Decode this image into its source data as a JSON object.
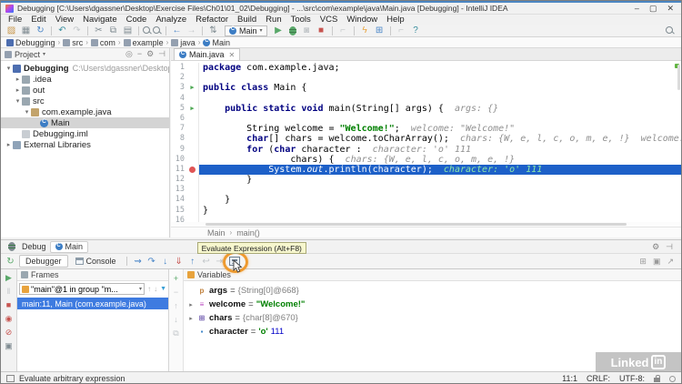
{
  "window": {
    "title": "Debugging [C:\\Users\\dgassner\\Desktop\\Exercise Files\\Ch01\\01_02\\Debugging] - ...\\src\\com\\example\\java\\Main.java [Debugging] - IntelliJ IDEA",
    "minimize": "–",
    "maximize": "▢",
    "close": "✕"
  },
  "menu": [
    "File",
    "Edit",
    "View",
    "Navigate",
    "Code",
    "Analyze",
    "Refactor",
    "Build",
    "Run",
    "Tools",
    "VCS",
    "Window",
    "Help"
  ],
  "toolbar": {
    "run_config": "Main",
    "icons": [
      {
        "name": "open",
        "g": "▨",
        "c": "folder"
      },
      {
        "name": "save-all",
        "g": "▦",
        "c": "g"
      },
      {
        "name": "sync",
        "g": "↻",
        "c": "b"
      },
      {
        "name": "sep"
      },
      {
        "name": "undo",
        "g": "↶",
        "c": "t"
      },
      {
        "name": "redo",
        "g": "↷",
        "c": "d"
      },
      {
        "name": "sep"
      },
      {
        "name": "cut",
        "g": "✂",
        "c": "g"
      },
      {
        "name": "copy",
        "g": "⧉",
        "c": "g"
      },
      {
        "name": "paste",
        "g": "▤",
        "c": "g"
      },
      {
        "name": "sep"
      },
      {
        "name": "find",
        "g": "mag"
      },
      {
        "name": "replace",
        "g": "mag"
      },
      {
        "name": "sep"
      },
      {
        "name": "back",
        "g": "←",
        "c": "b"
      },
      {
        "name": "forward",
        "g": "→",
        "c": "d"
      },
      {
        "name": "sep"
      },
      {
        "name": "sort-lines",
        "g": "⇅",
        "c": "g"
      },
      {
        "name": "runconfig"
      },
      {
        "name": "run",
        "g": "▶",
        "c": "grn"
      },
      {
        "name": "debug",
        "g": "bug"
      },
      {
        "name": "run-with-coverage",
        "g": "◙",
        "c": "d"
      },
      {
        "name": "stop",
        "g": "■",
        "c": "red"
      },
      {
        "name": "sep"
      },
      {
        "name": "attach-profiler",
        "g": "⌐",
        "c": "d"
      },
      {
        "name": "sep"
      },
      {
        "name": "find-action",
        "g": "ϟ",
        "c": "y"
      },
      {
        "name": "project-structure",
        "g": "⊞",
        "c": "b"
      },
      {
        "name": "sep"
      },
      {
        "name": "disabled-tool",
        "g": "⌐",
        "c": "d"
      },
      {
        "name": "help",
        "g": "?",
        "c": "t"
      }
    ]
  },
  "breadcrumbs": [
    {
      "label": "Debugging",
      "icon": "project"
    },
    {
      "label": "src",
      "icon": "folder"
    },
    {
      "label": "com",
      "icon": "folder"
    },
    {
      "label": "example",
      "icon": "folder"
    },
    {
      "label": "java",
      "icon": "folder"
    },
    {
      "label": "Main",
      "icon": "class"
    }
  ],
  "project": {
    "header": "Project",
    "header_icons": [
      {
        "name": "locate-file",
        "g": "◎"
      },
      {
        "name": "collapse-all",
        "g": "−"
      },
      {
        "name": "settings-gear",
        "g": "⚙"
      },
      {
        "name": "hide-panel",
        "g": "⊣"
      }
    ],
    "tree": [
      {
        "level": 0,
        "chev": "▾",
        "icon": "project",
        "name": "Debugging",
        "suffix": "C:\\Users\\dgassner\\Desktop\\Exercise Files\\Ch",
        "bold": true
      },
      {
        "level": 1,
        "chev": "▸",
        "icon": "folder",
        "name": ".idea"
      },
      {
        "level": 1,
        "chev": "▸",
        "icon": "folder",
        "name": "out"
      },
      {
        "level": 1,
        "chev": "▾",
        "icon": "folder",
        "name": "src"
      },
      {
        "level": 2,
        "chev": "▾",
        "icon": "package",
        "name": "com.example.java"
      },
      {
        "level": 3,
        "chev": "",
        "icon": "class",
        "name": "Main",
        "selected": true
      },
      {
        "level": 1,
        "chev": "",
        "icon": "file",
        "name": "Debugging.iml"
      },
      {
        "level": 0,
        "chev": "▸",
        "icon": "lib",
        "name": "External Libraries"
      }
    ]
  },
  "editor": {
    "tab": "Main.java",
    "tab_close": "✕",
    "breadcrumb": [
      "Main",
      "main()"
    ],
    "lines": [
      {
        "n": 1,
        "seg": [
          [
            "k",
            "package "
          ],
          [
            "p",
            "com.example.java;"
          ]
        ]
      },
      {
        "n": 2,
        "seg": []
      },
      {
        "n": 3,
        "icon": "run",
        "seg": [
          [
            "k",
            "public class "
          ],
          [
            "p",
            "Main {"
          ]
        ]
      },
      {
        "n": 4,
        "seg": []
      },
      {
        "n": 5,
        "icon": "run",
        "seg": [
          [
            "p",
            "    "
          ],
          [
            "k",
            "public static void "
          ],
          [
            "p",
            "main(String[] args) {  "
          ],
          [
            "h",
            "args: {}"
          ]
        ]
      },
      {
        "n": 6,
        "seg": []
      },
      {
        "n": 7,
        "seg": [
          [
            "p",
            "        String welcome = "
          ],
          [
            "s",
            "\"Welcome!\""
          ],
          [
            "p",
            ";  "
          ],
          [
            "h",
            "welcome: \"Welcome!\""
          ]
        ]
      },
      {
        "n": 8,
        "seg": [
          [
            "p",
            "        "
          ],
          [
            "k",
            "char"
          ],
          [
            "p",
            "[] chars = welcome.toCharArray();  "
          ],
          [
            "h",
            "chars: {W, e, l, c, o, m, e, !}  welcome: \"Welco"
          ]
        ]
      },
      {
        "n": 9,
        "seg": [
          [
            "p",
            "        "
          ],
          [
            "k",
            "for"
          ],
          [
            "p",
            " ("
          ],
          [
            "k",
            "char"
          ],
          [
            "p",
            " character :  "
          ],
          [
            "h",
            "character: 'o' 111"
          ]
        ]
      },
      {
        "n": 10,
        "seg": [
          [
            "p",
            "                chars) {  "
          ],
          [
            "h",
            "chars: {W, e, l, c, o, m, e, !}"
          ]
        ]
      },
      {
        "n": 11,
        "icon": "bp",
        "exec": true,
        "seg": [
          [
            "p",
            "            System."
          ],
          [
            "it",
            "out"
          ],
          [
            "p",
            ".println(character);  "
          ],
          [
            "hx",
            "character: 'o' 111"
          ]
        ]
      },
      {
        "n": 12,
        "seg": [
          [
            "p",
            "        }"
          ]
        ]
      },
      {
        "n": 13,
        "seg": []
      },
      {
        "n": 14,
        "seg": [
          [
            "p",
            "    }"
          ]
        ]
      },
      {
        "n": 15,
        "seg": [
          [
            "p",
            "}"
          ]
        ]
      },
      {
        "n": 16,
        "seg": []
      }
    ]
  },
  "debug": {
    "tool_tab": "Debug",
    "session_tab": "Main",
    "tabs": [
      "Debugger",
      "Console"
    ],
    "tooltip": "Evaluate Expression (Alt+F8)",
    "rerun": {
      "name": "rerun",
      "g": "↻",
      "c": "grn"
    },
    "steppers": [
      {
        "name": "show-execution-point",
        "g": "⇝",
        "c": "b"
      },
      {
        "name": "step-over",
        "g": "↷",
        "c": "b"
      },
      {
        "name": "step-into",
        "g": "↓",
        "c": "b"
      },
      {
        "name": "force-step-into",
        "g": "⇓",
        "c": "red"
      },
      {
        "name": "step-out",
        "g": "↑",
        "c": "b"
      },
      {
        "name": "drop-frame",
        "g": "↩",
        "c": "d"
      },
      {
        "name": "run-to-cursor",
        "g": "⇥",
        "c": "d"
      },
      {
        "name": "evaluate-expression",
        "g": "calc"
      }
    ],
    "row1_icons": [
      {
        "name": "settings-gear",
        "g": "⚙"
      },
      {
        "name": "hide-panel",
        "g": "⊣"
      }
    ],
    "row2_icons": [
      {
        "name": "layout-settings",
        "g": "⊞"
      },
      {
        "name": "restore-layout",
        "g": "▣"
      },
      {
        "name": "pin-tab",
        "g": "↗"
      }
    ],
    "strip": [
      {
        "name": "resume-program",
        "g": "▶",
        "c": "grn"
      },
      {
        "name": "pause-program",
        "g": "‖",
        "c": "d"
      },
      {
        "name": "stop-program",
        "g": "■",
        "c": "red"
      },
      {
        "name": "view-breakpoints",
        "g": "◉",
        "c": "red"
      },
      {
        "name": "mute-breakpoints",
        "g": "⊘",
        "c": "red"
      },
      {
        "name": "thread-dump",
        "g": "▣",
        "c": "g"
      }
    ],
    "frames": {
      "header": "Frames",
      "thread": "\"main\"@1 in group \"m...",
      "dropdown_arrow": "▾",
      "frame": "main:11, Main (com.example.java)"
    },
    "watch_toolbar": [
      {
        "name": "new-watch",
        "g": "+",
        "c": "grn"
      },
      {
        "name": "remove-watch",
        "g": "−",
        "c": "d"
      },
      {
        "name": "move-watch-up",
        "g": "↑",
        "c": "d"
      },
      {
        "name": "move-watch-down",
        "g": "↓",
        "c": "d"
      },
      {
        "name": "duplicate-watch",
        "g": "⧉",
        "c": "d"
      }
    ],
    "variables": {
      "header": "Variables",
      "items": [
        {
          "chev": "",
          "icon": "param",
          "name": "args",
          "value": [
            [
              "v-ref",
              "{String[0]@668}"
            ]
          ]
        },
        {
          "chev": "▸",
          "icon": "field",
          "name": "welcome",
          "value": [
            [
              "v-str",
              "\"Welcome!\""
            ]
          ]
        },
        {
          "chev": "▸",
          "icon": "array",
          "name": "chars",
          "value": [
            [
              "v-ref",
              "{char[8]@670}"
            ]
          ]
        },
        {
          "chev": "",
          "icon": "prim",
          "name": "character",
          "value": [
            [
              "v-str",
              "'o' "
            ],
            [
              "v-num",
              "111"
            ]
          ]
        }
      ]
    }
  },
  "status": {
    "message": "Evaluate arbitrary expression",
    "position": "11:1",
    "line_separator": "CRLF:",
    "encoding": "UTF-8:"
  },
  "watermark": {
    "text": "Linked",
    "badge": "in"
  }
}
